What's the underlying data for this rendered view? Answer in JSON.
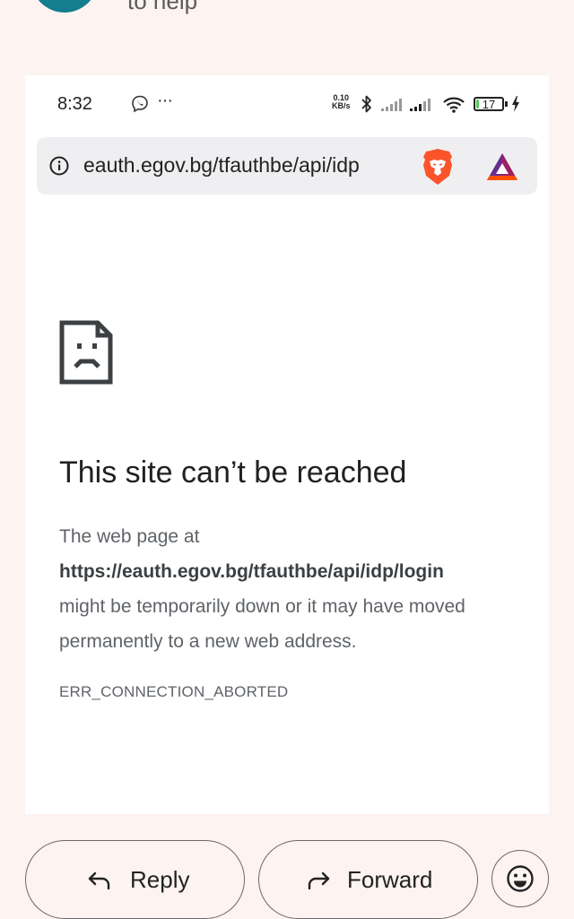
{
  "colors": {
    "background": "#fdf3f1",
    "avatar": "#147d8e",
    "battery_fill": "#5fc35f",
    "brave_orange": "#fb542b",
    "bat_purple": "#662d91"
  },
  "header": {
    "partial_text": "to help"
  },
  "status_bar": {
    "time": "8:32",
    "overflow": "···",
    "net_speed_value": "0.10",
    "net_speed_unit": "KB/s",
    "battery_level": "17",
    "icons": [
      "viber-icon",
      "bluetooth-icon",
      "signal-icon",
      "signal-icon",
      "wifi-icon",
      "battery-icon",
      "charging-icon"
    ]
  },
  "browser": {
    "url": "eauth.egov.bg/tfauthbe/api/idp",
    "icons": [
      "info-icon",
      "brave-lion-icon",
      "bat-rewards-icon"
    ]
  },
  "error_page": {
    "icon": "sad-document-icon",
    "title": "This site can’t be reached",
    "body_prefix": "The web page at",
    "url": "https://eauth.egov.bg/tfauthbe/api/idp/login",
    "body_suffix": "might be temporarily down or it may have moved permanently to a new web address.",
    "error_code": "ERR_CONNECTION_ABORTED"
  },
  "actions": {
    "reply_label": "Reply",
    "forward_label": "Forward",
    "emoji_icon": "smiley-icon"
  }
}
